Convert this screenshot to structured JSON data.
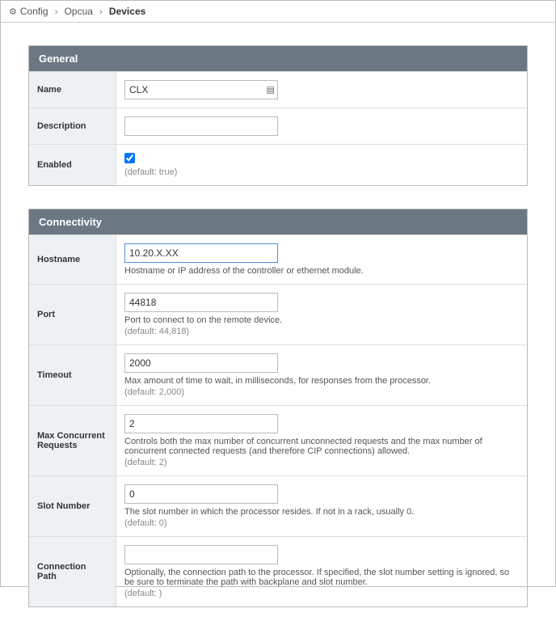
{
  "breadcrumb": {
    "config_label": "Config",
    "opcua_label": "Opcua",
    "devices_label": "Devices"
  },
  "sections": {
    "general": {
      "title": "General",
      "name_label": "Name",
      "name_value": "CLX",
      "description_label": "Description",
      "description_value": "",
      "enabled_label": "Enabled",
      "enabled_default": "(default: true)"
    },
    "connectivity": {
      "title": "Connectivity",
      "hostname": {
        "label": "Hostname",
        "value": "10.20.X.XX",
        "hint": "Hostname or IP address of the controller or ethernet module."
      },
      "port": {
        "label": "Port",
        "value": "44818",
        "hint": "Port to connect to on the remote device.",
        "default": "(default: 44,818)"
      },
      "timeout": {
        "label": "Timeout",
        "value": "2000",
        "hint": "Max amount of time to wait, in milliseconds, for responses from the processor.",
        "default": "(default: 2,000)"
      },
      "max_concurrent": {
        "label": "Max Concurrent Requests",
        "value": "2",
        "hint": "Controls both the max number of concurrent unconnected requests and the max number of concurrent connected requests (and therefore CIP connections) allowed.",
        "default": "(default: 2)"
      },
      "slot": {
        "label": "Slot Number",
        "value": "0",
        "hint": "The slot number in which the processor resides. If not in a rack, usually 0.",
        "default": "(default: 0)"
      },
      "conn_path": {
        "label": "Connection Path",
        "value": "",
        "hint": "Optionally, the connection path to the processor. If specified, the slot number setting is ignored, so be sure to terminate the path with backplane and slot number.",
        "default": "(default: )"
      }
    }
  }
}
